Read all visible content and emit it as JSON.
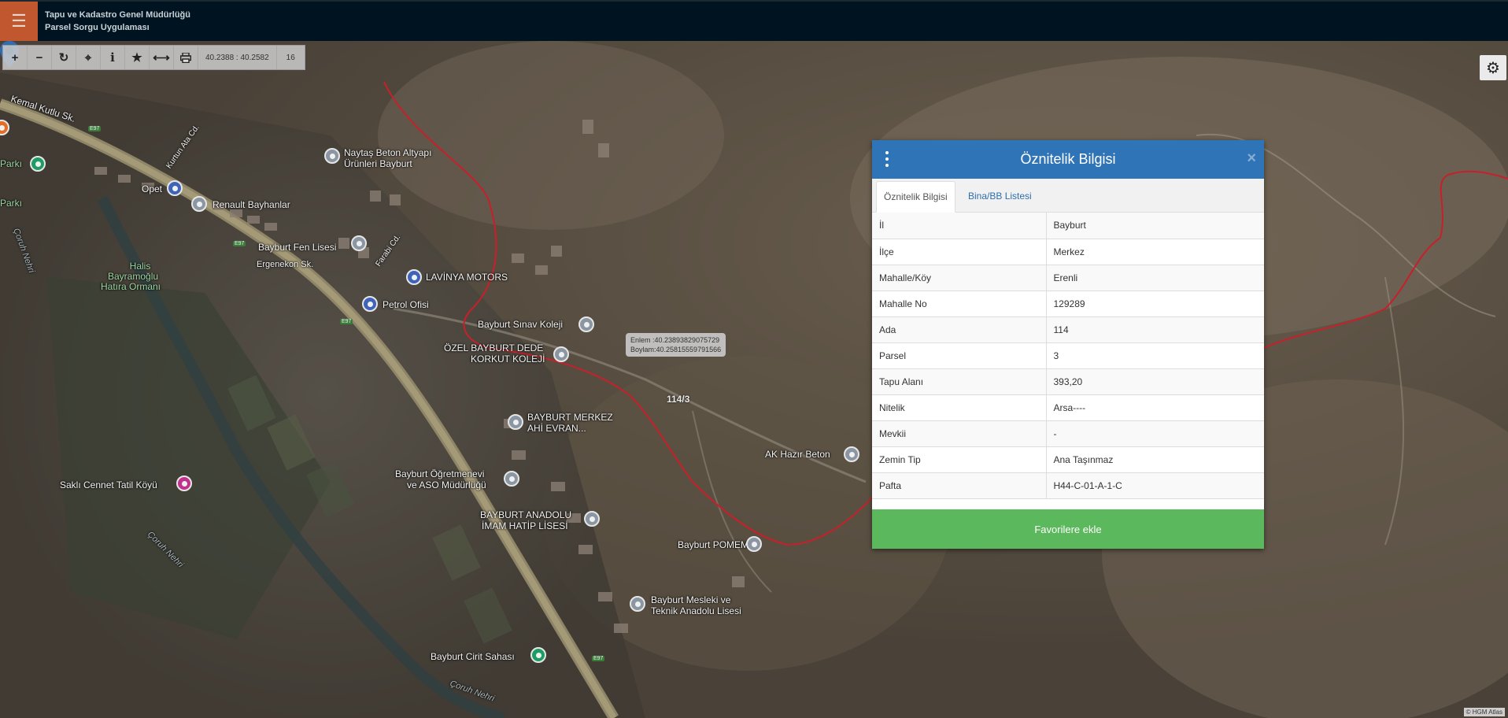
{
  "header": {
    "org_title": "Tapu ve Kadastro Genel Müdürlüğü",
    "app_title": "Parsel Sorgu Uygulaması"
  },
  "toolbar": {
    "coordinates": "40.2388 : 40.2582",
    "zoom": "16"
  },
  "map": {
    "labels": {
      "kemal_kutlu": "Kemal Kutlu Sk.",
      "park_a": "Parkı",
      "park_b": "Parkı",
      "naytas_1": "Naytaş Beton Altyapı",
      "naytas_2": "Ürünleri Bayburt",
      "opet": "Opet",
      "renault": "Renault Bayhanlar",
      "kurtun": "Kurtun Ata Cd.",
      "fen_lisesi": "Bayburt Fen Lisesi",
      "ergenekon": "Ergenekon Sk.",
      "farabi": "Farabi Cd.",
      "lavinya": "LAVİNYA MOTORS",
      "halis_1": "Halis",
      "halis_2": "Bayramoğlu",
      "halis_3": "Hatıra Ormanı",
      "petrol": "Petrol Ofisi",
      "sinav": "Bayburt Sınav Koleji",
      "dede_1": "ÖZEL BAYBURT DEDE",
      "dede_2": "KORKUT KOLEJİ",
      "ahi_1": "BAYBURT MERKEZ",
      "ahi_2": "AHİ EVRAN...",
      "ak_beton": "AK Hazır Beton",
      "ogretmen_1": "Bayburt Öğretmenevi",
      "ogretmen_2": "ve ASO Müdürlüğü",
      "sakli": "Saklı Cennet Tatil Köyü",
      "imam_1": "BAYBURT ANADOLU",
      "imam_2": "İMAM HATİP LİSESİ",
      "pomem": "Bayburt POMEM",
      "mesleki_1": "Bayburt Mesleki ve",
      "mesleki_2": "Teknik Anadolu Lisesi",
      "cirit": "Bayburt Cirit Sahası",
      "coruh_1": "Çoruh Nehri",
      "coruh_2": "Çoruh Nehri",
      "coruh_3": "Çoruh Nehri"
    },
    "road_badges": {
      "b1": "E97",
      "b2": "E97",
      "b3": "E97",
      "b4": "E97"
    },
    "tooltip": {
      "lat": "Enlem :40.23893829075729",
      "lon": "Boylam:40.25815559791566"
    },
    "parcel_label": "114/3",
    "attribution": "© HGM Atlas"
  },
  "panel": {
    "title": "Öznitelik Bilgisi",
    "tabs": [
      {
        "label": "Öznitelik Bilgisi",
        "active": true
      },
      {
        "label": "Bina/BB Listesi",
        "active": false
      }
    ],
    "rows": [
      {
        "key": "İl",
        "value": "Bayburt"
      },
      {
        "key": "İlçe",
        "value": "Merkez"
      },
      {
        "key": "Mahalle/Köy",
        "value": "Erenli"
      },
      {
        "key": "Mahalle No",
        "value": "129289"
      },
      {
        "key": "Ada",
        "value": "114"
      },
      {
        "key": "Parsel",
        "value": "3"
      },
      {
        "key": "Tapu Alanı",
        "value": "393,20"
      },
      {
        "key": "Nitelik",
        "value": "Arsa----"
      },
      {
        "key": "Mevkii",
        "value": "-"
      },
      {
        "key": "Zemin Tip",
        "value": "Ana Taşınmaz"
      },
      {
        "key": "Pafta",
        "value": "H44-C-01-A-1-C"
      }
    ],
    "favorite_label": "Favorilere ekle"
  },
  "colors": {
    "header_bg": "#001320",
    "menu_accent": "#c0572f",
    "panel_header": "#3074b8",
    "favorite_button": "#5cb85c",
    "boundary_line": "#c8202a"
  },
  "icons": {
    "menu": "hamburger-icon",
    "zoom_in": "plus-icon",
    "zoom_out": "minus-icon",
    "refresh": "refresh-icon",
    "locate": "crosshair-icon",
    "info": "info-icon",
    "favorite": "star-icon",
    "measure": "ruler-icon",
    "print": "printer-icon",
    "settings": "gear-icon",
    "panel_menu": "kebab-menu-icon",
    "close": "close-icon",
    "marker": "map-pin-icon"
  }
}
